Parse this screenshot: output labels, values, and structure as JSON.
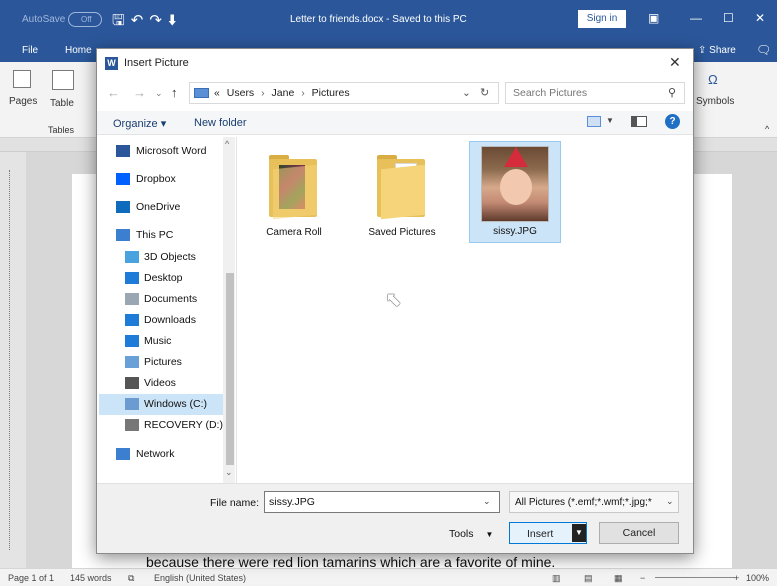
{
  "word": {
    "autosave_label": "AutoSave",
    "autosave_state": "Off",
    "document_title": "Letter to friends.docx  -  Saved to this PC",
    "sign_in": "Sign in",
    "tabs": [
      "File",
      "Home"
    ],
    "share": "Share",
    "ribbon": {
      "pages": "Pages",
      "table": "Table",
      "tables_group": "Tables",
      "symbols": "Symbols",
      "omega": "Ω"
    },
    "doc_text": "because there were red lion tamarins which are a favorite of mine.",
    "status": {
      "page": "Page 1 of 1",
      "words": "145 words",
      "language": "English (United States)",
      "zoom": "100%"
    }
  },
  "dialog": {
    "title": "Insert Picture",
    "address": {
      "prefix": "«",
      "crumbs": [
        "Users",
        "Jane",
        "Pictures"
      ]
    },
    "search_placeholder": "Search Pictures",
    "organize": "Organize ▾",
    "new_folder": "New folder",
    "sidebar": [
      {
        "label": "Microsoft Word",
        "icon": "word-icon",
        "indent": false
      },
      {
        "label": "Dropbox",
        "icon": "dropbox-icon",
        "indent": false
      },
      {
        "label": "OneDrive",
        "icon": "onedrive-icon",
        "indent": false
      },
      {
        "label": "This PC",
        "icon": "pc-icon",
        "indent": false
      },
      {
        "label": "3D Objects",
        "icon": "3d-objects-icon",
        "indent": true
      },
      {
        "label": "Desktop",
        "icon": "desktop-icon",
        "indent": true
      },
      {
        "label": "Documents",
        "icon": "documents-icon",
        "indent": true
      },
      {
        "label": "Downloads",
        "icon": "downloads-icon",
        "indent": true
      },
      {
        "label": "Music",
        "icon": "music-icon",
        "indent": true
      },
      {
        "label": "Pictures",
        "icon": "pictures-icon",
        "indent": true
      },
      {
        "label": "Videos",
        "icon": "videos-icon",
        "indent": true
      },
      {
        "label": "Windows (C:)",
        "icon": "drive-c-icon",
        "indent": true,
        "selected": true
      },
      {
        "label": "RECOVERY (D:)",
        "icon": "drive-d-icon",
        "indent": true
      },
      {
        "label": "Network",
        "icon": "network-icon",
        "indent": false
      }
    ],
    "files": [
      {
        "label": "Camera Roll",
        "kind": "photo-folder"
      },
      {
        "label": "Saved Pictures",
        "kind": "doc-folder"
      },
      {
        "label": "sissy.JPG",
        "kind": "image",
        "selected": true
      }
    ],
    "file_name_label": "File name:",
    "file_name_value": "sissy.JPG",
    "file_type": "All Pictures (*.emf;*.wmf;*.jpg;*",
    "tools": "Tools",
    "insert": "Insert",
    "cancel": "Cancel"
  }
}
